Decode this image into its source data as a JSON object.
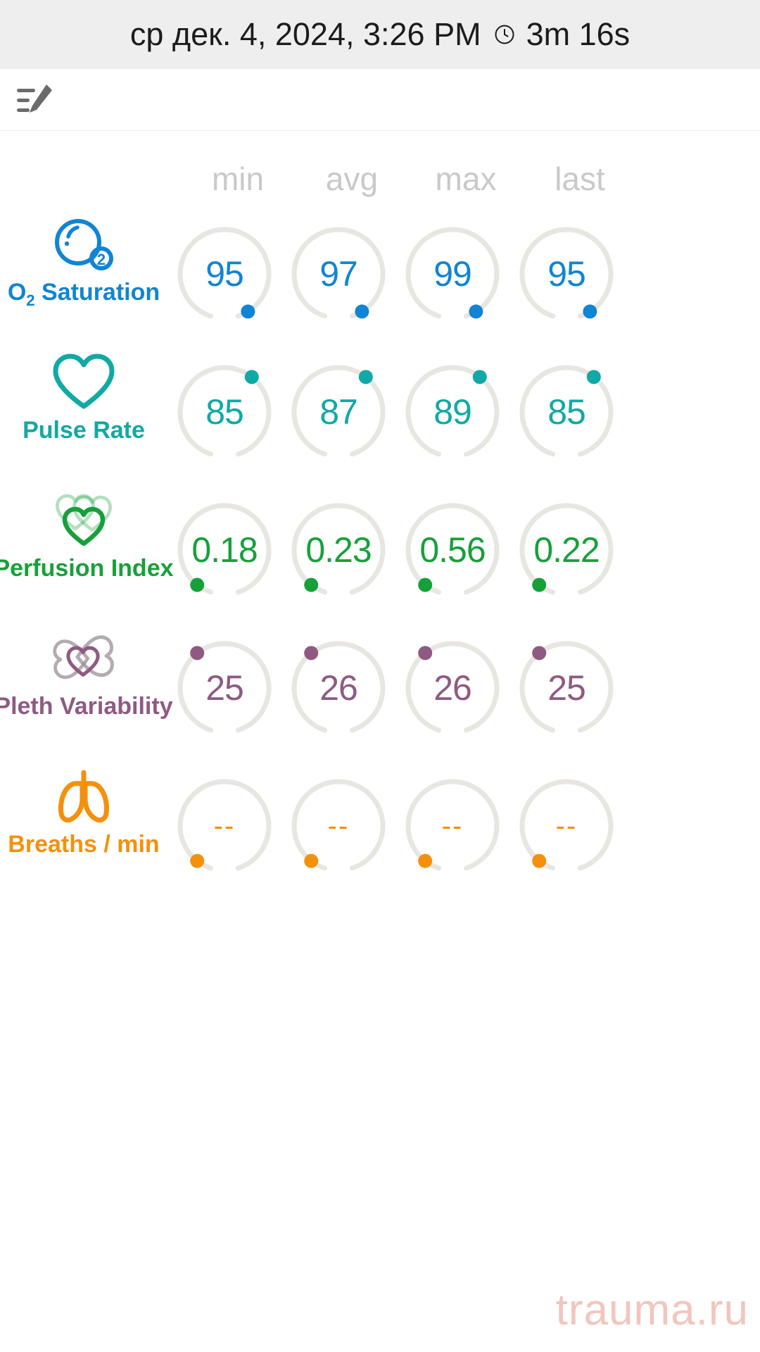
{
  "header": {
    "datetime": "ср дек. 4, 2024, 3:26 PM",
    "clock_icon": "clock-icon",
    "duration": "3m 16s"
  },
  "toolbar": {
    "note_icon": "note-edit-icon"
  },
  "columns": [
    {
      "label": "min"
    },
    {
      "label": "avg"
    },
    {
      "label": "max"
    },
    {
      "label": "last"
    }
  ],
  "colors": {
    "spo2": "#1184d4",
    "pulse": "#11a9a5",
    "perfusion": "#17a03a",
    "pleth": "#8e5a82",
    "breaths": "#f5900d",
    "ring": "#e8e6e1",
    "header_bg": "#eeeeee",
    "col_header": "#c9c9c9",
    "watermark": "#f2c6bd"
  },
  "metrics": [
    {
      "id": "spo2",
      "label": "O₂ Saturation",
      "icon": "oxygen-bubble-icon",
      "color": "#1184d4",
      "dot_angle": 58,
      "values": [
        "95",
        "97",
        "99",
        "95"
      ]
    },
    {
      "id": "pulse",
      "label": "Pulse Rate",
      "icon": "heart-outline-icon",
      "color": "#11a9a5",
      "dot_angle": -52,
      "values": [
        "85",
        "87",
        "89",
        "85"
      ]
    },
    {
      "id": "perfusion",
      "label": "Perfusion Index",
      "icon": "triple-heart-icon",
      "color": "#17a03a",
      "dot_angle": 128,
      "values": [
        "0.18",
        "0.23",
        "0.56",
        "0.22"
      ]
    },
    {
      "id": "pleth",
      "label": "Pleth Variability",
      "icon": "overlapping-hearts-icon",
      "color": "#8e5a82",
      "dot_angle": -128,
      "values": [
        "25",
        "26",
        "26",
        "25"
      ]
    },
    {
      "id": "breaths",
      "label": "Breaths / min",
      "icon": "lungs-icon",
      "color": "#f5900d",
      "dot_angle": 128,
      "values": [
        "--",
        "--",
        "--",
        "--"
      ]
    }
  ],
  "watermark": {
    "text": "trauma.ru"
  }
}
